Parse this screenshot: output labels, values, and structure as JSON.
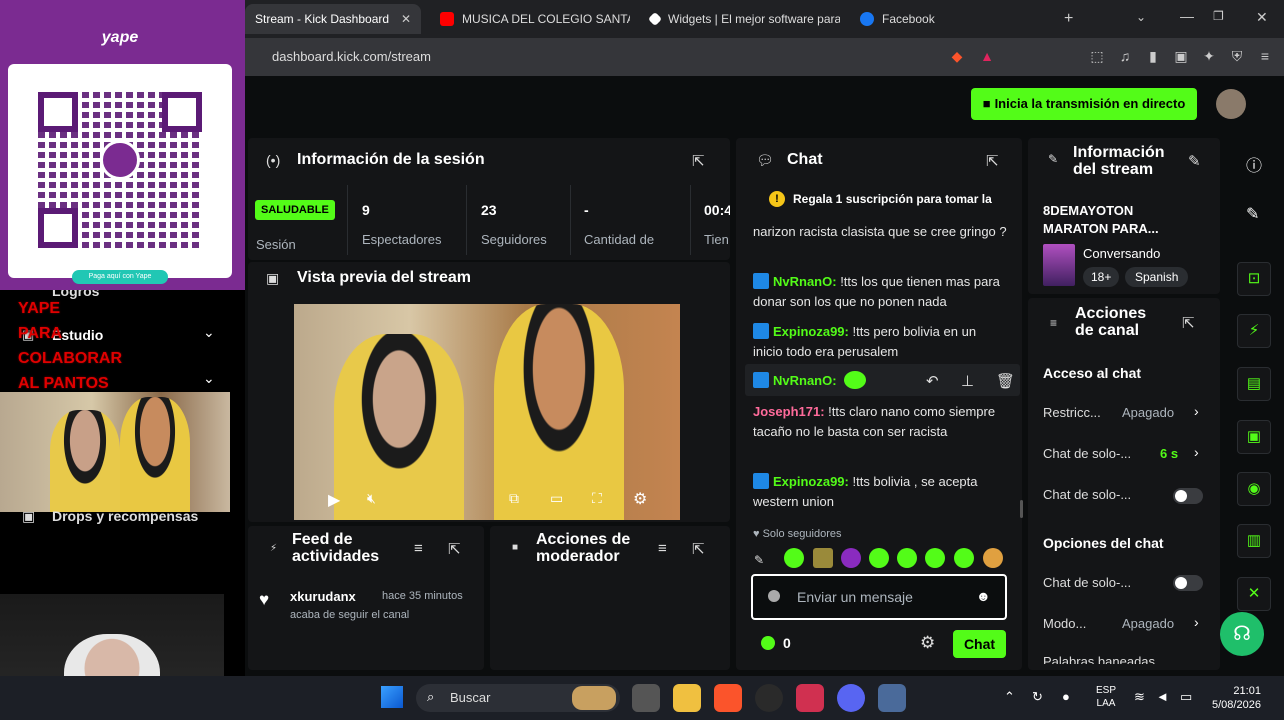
{
  "browser": {
    "tabs": [
      {
        "label": "Stream - Kick Dashboard",
        "color": "#53fc18"
      },
      {
        "label": "MUSICA DEL COLEGIO SANTA M",
        "color": "#ff0000"
      },
      {
        "label": "Widgets | El mejor software para",
        "color": "#ffffff"
      },
      {
        "label": "Facebook",
        "color": "#1877f2"
      }
    ],
    "new_tab": "+",
    "url": "dashboard.kick.com/stream"
  },
  "header": {
    "go_live_label": "Inicia la transmisión en directo"
  },
  "session": {
    "title": "Información de la sesión",
    "status_badge": "SALUDABLE",
    "status_label": "Sesión",
    "stats": [
      {
        "value": "9",
        "label": "Espectadores"
      },
      {
        "value": "23",
        "label": "Seguidores"
      },
      {
        "value": "-",
        "label": "Cantidad de"
      },
      {
        "value": "00:4",
        "label": "Tien"
      }
    ]
  },
  "preview": {
    "title": "Vista previa del stream"
  },
  "activity": {
    "title_line1": "Feed de",
    "title_line2": "actividades",
    "items": [
      {
        "user": "xkurudanx",
        "time": "hace 35 minutos",
        "text": "acaba de seguir el canal"
      }
    ]
  },
  "mod": {
    "title_line1": "Acciones de",
    "title_line2": "moderador"
  },
  "chat": {
    "title": "Chat",
    "pinned": "Regala 1 suscripción para tomar la",
    "partial_top": "narizon racista clasista que se cree gringo ?",
    "messages": [
      {
        "user": "NvRnanO:",
        "text": "!tts los que tienen mas para donar son los que no ponen nada"
      },
      {
        "user": "Expinoza99:",
        "text": "!tts pero bolivia en un inicio todo era perusalem"
      },
      {
        "user": "NvRnanO:",
        "text": ""
      },
      {
        "user": "Joseph171:",
        "text": "!tts claro nano como siempre tacaño no le basta con ser racista"
      },
      {
        "user": "Expinoza99:",
        "text": "!tts bolivia , se acepta western union"
      }
    ],
    "followers_only": "Solo seguidores",
    "input_placeholder": "Enviar un mensaje",
    "points": "0",
    "send_label": "Chat"
  },
  "stream_info": {
    "title_line1": "Información",
    "title_line2": "del stream",
    "stream_title_line1": "8DEMAYOTON",
    "stream_title_line2": "MARATON PARA...",
    "category": "Conversando",
    "tags": [
      "18+",
      "Spanish"
    ]
  },
  "channel_actions": {
    "title_line1": "Acciones",
    "title_line2": "de canal",
    "chat_access_heading": "Acceso al chat",
    "rows": [
      {
        "label": "Restricc...",
        "value": "Apagado"
      },
      {
        "label": "Chat de solo-...",
        "value": "6 s"
      },
      {
        "label": "Chat de solo-...",
        "value": ""
      }
    ],
    "options_heading": "Opciones del chat",
    "option_rows": [
      {
        "label": "Chat de solo-...",
        "value": ""
      },
      {
        "label": "Modo...",
        "value": "Apagado"
      },
      {
        "label": "Palabras baneadas",
        "value": ""
      }
    ]
  },
  "overlay": {
    "yape_brand": "yape",
    "yape_caption": "Paga aquí con Yape",
    "banner_words": [
      "YAPE",
      "PARA",
      "COLABORAR",
      "AL PANTOS"
    ],
    "sidebar_items": [
      "Logros",
      "Estudio",
      "Drops y recompensas"
    ]
  },
  "taskbar": {
    "search_label": "Buscar",
    "lang_line1": "ESP",
    "lang_line2": "LAA",
    "time": "21:01",
    "date": "5/08/2026"
  }
}
